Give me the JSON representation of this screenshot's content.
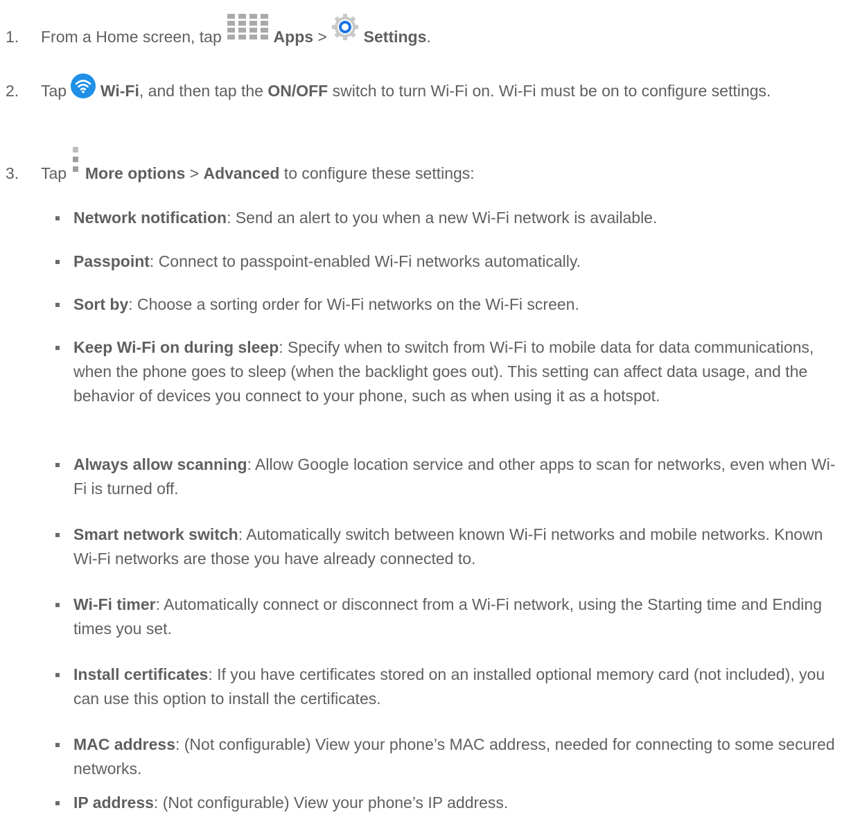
{
  "steps": [
    {
      "number": "1.",
      "before": "From a Home screen, tap",
      "apps_icon": "apps-grid-icon",
      "apps_label": "Apps",
      "sep": " > ",
      "settings_icon": "settings-gear-icon",
      "settings_label": "Settings",
      "end": "."
    },
    {
      "number": "2.",
      "before": "Tap",
      "wifi_icon": "wifi-icon",
      "wifi_label": "Wi-Fi",
      "mid": ", and then tap the ",
      "switch_label": "ON/OFF",
      "after": " switch to turn Wi-Fi on. Wi-Fi must be on to configure settings."
    },
    {
      "number": "3.",
      "before": "Tap",
      "more_icon": "more-options-icon",
      "more_label": "More options",
      "sep": " > ",
      "advanced_label": "Advanced",
      "after": " to configure these settings:"
    }
  ],
  "settings": [
    {
      "term": "Network notification",
      "desc": ": Send an alert to you when a new Wi-Fi network is available."
    },
    {
      "term": "Passpoint",
      "desc": ": Connect to passpoint-enabled Wi-Fi networks automatically."
    },
    {
      "term": "Sort by",
      "desc": ": Choose a sorting order for Wi-Fi networks on the Wi-Fi screen."
    },
    {
      "term": "Keep Wi-Fi on during sleep",
      "desc": ": Specify when to switch from Wi-Fi to mobile data for data communications, when the phone goes to sleep (when the backlight goes out). This setting can affect data usage, and the behavior of devices you connect to your phone, such as when using it as a hotspot."
    },
    {
      "term": "Always allow scanning",
      "desc": ": Allow Google location service and other apps to scan for networks, even when Wi-Fi is turned off."
    },
    {
      "term": "Smart network switch",
      "desc": ": Automatically switch between known Wi-Fi networks and mobile networks. Known Wi-Fi networks are those you have already connected to."
    },
    {
      "term": "Wi-Fi timer",
      "desc": ": Automatically connect or disconnect from a Wi-Fi network, using the Starting time and Ending times you set."
    },
    {
      "term": "Install certificates",
      "desc": ": If you have certificates stored on an installed optional memory card (not included), you can use this option to install the certificates."
    },
    {
      "term": "MAC address",
      "desc": ": (Not configurable) View your phone’s MAC address, needed for connecting to some secured networks."
    },
    {
      "term": "IP address",
      "desc": ": (Not configurable) View your phone’s IP address."
    }
  ]
}
